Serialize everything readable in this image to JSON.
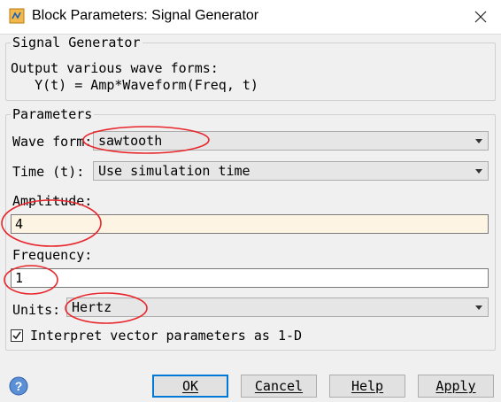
{
  "window": {
    "title": "Block Parameters: Signal Generator",
    "close_symbol": "✕"
  },
  "description_group": {
    "legend": "Signal Generator",
    "line1": "Output various wave forms:",
    "line2": "   Y(t) = Amp*Waveform(Freq, t)"
  },
  "parameters_group": {
    "legend": "Parameters",
    "wave_form": {
      "label": "Wave form:",
      "value": "sawtooth"
    },
    "time": {
      "label": "Time (t):",
      "value": "Use simulation time"
    },
    "amplitude": {
      "label": "Amplitude:",
      "value": "4"
    },
    "frequency": {
      "label": "Frequency:",
      "value": "1"
    },
    "units": {
      "label": "Units:",
      "value": "Hertz"
    },
    "interpret_vector": {
      "label": "Interpret vector parameters as 1-D",
      "checked": true
    }
  },
  "buttons": {
    "ok": "OK",
    "cancel": "Cancel",
    "help": "Help",
    "apply": "Apply"
  },
  "colors": {
    "annotation_red": "#e8262b",
    "amplitude_bg": "#fdf4e3",
    "focus_blue": "#0078d7"
  },
  "icons": {
    "app": "simulink-block-icon",
    "help": "help-question-icon"
  }
}
